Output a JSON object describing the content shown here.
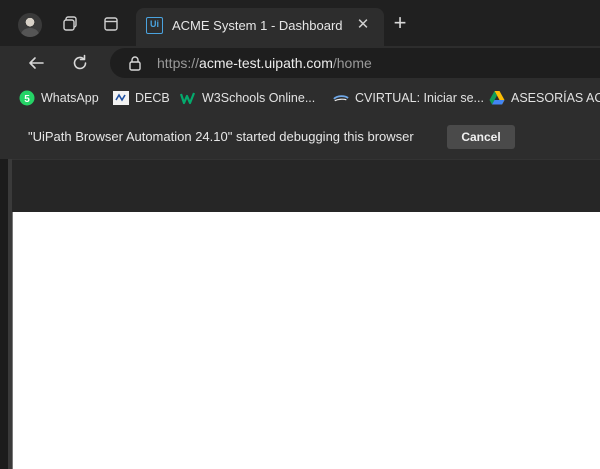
{
  "tab": {
    "title": "ACME System 1 - Dashboard",
    "favicon_text": "Ui",
    "close_glyph": "✕"
  },
  "new_tab_glyph": "+",
  "address": {
    "scheme": "https://",
    "host": "acme-test.uipath.com",
    "path": "/home"
  },
  "bookmarks": [
    {
      "label": "WhatsApp",
      "icon": "whatsapp-icon"
    },
    {
      "label": "DECB",
      "icon": "decb-icon"
    },
    {
      "label": "W3Schools Online...",
      "icon": "w3schools-icon"
    },
    {
      "label": "CVIRTUAL: Iniciar se...",
      "icon": "cvirtual-icon"
    },
    {
      "label": "ASESORÍAS ACAD",
      "icon": "google-drive-icon"
    }
  ],
  "infobar": {
    "message": "\"UiPath Browser Automation 24.10\" started debugging this browser",
    "cancel_label": "Cancel"
  },
  "colors": {
    "chrome_dark": "#202020",
    "toolbar": "#2d2d2d",
    "page_background": "#ffffff",
    "whatsapp": "#25d366",
    "w3schools": "#04aa6d"
  }
}
